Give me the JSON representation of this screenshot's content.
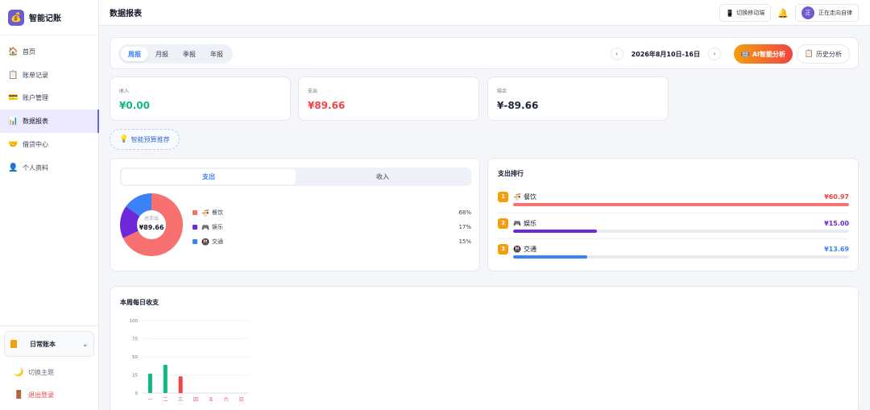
{
  "app": {
    "name": "智能记账",
    "logo_icon": "moneybag-icon"
  },
  "sidebar": {
    "items": [
      {
        "label": "首页",
        "icon": "🏠",
        "active": false
      },
      {
        "label": "账单记录",
        "icon": "📋",
        "active": false
      },
      {
        "label": "账户管理",
        "icon": "💳",
        "active": false
      },
      {
        "label": "数据报表",
        "icon": "📊",
        "active": true
      },
      {
        "label": "借贷中心",
        "icon": "🤝",
        "active": false
      },
      {
        "label": "个人资料",
        "icon": "👤",
        "active": false
      }
    ],
    "ledger": "日常账本",
    "theme_label": "切换主题",
    "logout_label": "退出登录"
  },
  "header": {
    "title": "数据报表",
    "mobile_label": "切换移动端",
    "user_avatar_text": "正",
    "user_name": "正在走向自律"
  },
  "toolbar": {
    "periods": [
      "周报",
      "月报",
      "季报",
      "年报"
    ],
    "active_period": "周报",
    "prev": "‹",
    "next": "›",
    "date_range": "2026年8月10日-16日",
    "ai_label": "AI智能分析",
    "history_label": "历史分析"
  },
  "stats": {
    "income": {
      "label": "收入",
      "value": "¥0.00"
    },
    "expense": {
      "label": "支出",
      "value": "¥89.66"
    },
    "balance": {
      "label": "结余",
      "value": "¥-89.66"
    }
  },
  "budget_label": "智能预算推荐",
  "distribution": {
    "tabs": [
      "支出",
      "收入"
    ],
    "active_tab": "支出",
    "center_label": "总支出",
    "center_value": "¥89.66",
    "items": [
      {
        "name": "餐饮",
        "icon": "🍜",
        "pct": "68%",
        "value": 68,
        "color": "#f87171"
      },
      {
        "name": "娱乐",
        "icon": "🎮",
        "pct": "17%",
        "value": 17,
        "color": "#6d28d9"
      },
      {
        "name": "交通",
        "icon": "🚇",
        "pct": "15%",
        "value": 15,
        "color": "#3b82f6"
      }
    ]
  },
  "ranking": {
    "title": "支出排行",
    "items": [
      {
        "rank": "1",
        "name": "餐饮",
        "icon": "🍜",
        "amount": "¥60.97",
        "fraction": 1.0,
        "color": "#f87171",
        "amount_color": "#ef4444"
      },
      {
        "rank": "2",
        "name": "娱乐",
        "icon": "🎮",
        "amount": "¥15.00",
        "fraction": 0.25,
        "color": "#6d28d9",
        "amount_color": "#6d28d9"
      },
      {
        "rank": "3",
        "name": "交通",
        "icon": "🚇",
        "amount": "¥13.69",
        "fraction": 0.22,
        "color": "#3b82f6",
        "amount_color": "#3b82f6"
      }
    ]
  },
  "chart_data": {
    "type": "bar",
    "title": "本周每日收支",
    "categories": [
      "一",
      "二",
      "三",
      "四",
      "五",
      "六",
      "日"
    ],
    "series": [
      {
        "name": "",
        "values": [
          27,
          39,
          0,
          0,
          0,
          0,
          0
        ],
        "color": "#10b981"
      },
      {
        "name": "",
        "values": [
          0,
          0,
          23,
          0,
          0,
          0,
          0
        ],
        "color": "#ef4444"
      }
    ],
    "y_ticks": [
      0,
      25,
      50,
      75,
      100
    ],
    "ylim": [
      0,
      100
    ],
    "grid": true
  }
}
